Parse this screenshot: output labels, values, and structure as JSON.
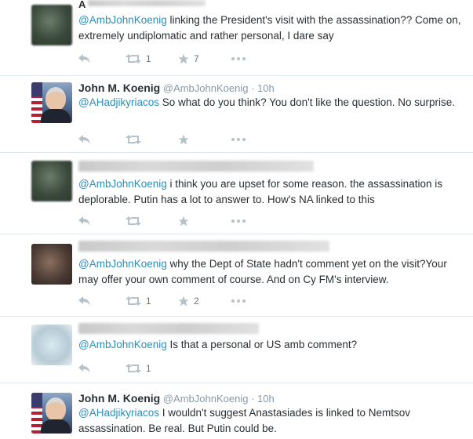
{
  "colors": {
    "mention": "#2a8fbd",
    "meta": "#8899a6",
    "icon": "#b6c2c9",
    "divider": "#e1e8ed",
    "text": "#292f33"
  },
  "tweets": [
    {
      "name_initial": "A",
      "mention": "@AmbJohnKoenig",
      "text": " linking the President's visit with the assassination?? Come on, extremely undiplomatic and rather personal, I dare say",
      "retweet_count": "1",
      "favorite_count": "7"
    },
    {
      "fullname": "John M. Koenig",
      "handle": "@AmbJohnKoenig",
      "dot": "·",
      "time": "10h",
      "mention": "@AHadjikyriacos",
      "text": " So what do you think?  You don't like the question. No surprise."
    },
    {
      "mention": "@AmbJohnKoenig",
      "text": " i think you are upset for some reason. the assassination is deplorable. Putin has a lot to answer to. How's NA linked to this"
    },
    {
      "mention": "@AmbJohnKoenig",
      "text": " why the Dept of State hadn't comment yet on the visit?Your may offer your own comment of course. And on Cy FM's interview.",
      "retweet_count": "1",
      "favorite_count": "2"
    },
    {
      "mention": "@AmbJohnKoenig",
      "text": "  Is that a personal  or US amb comment?",
      "retweet_count": "1"
    },
    {
      "fullname": "John M. Koenig",
      "handle": "@AmbJohnKoenig",
      "dot": "·",
      "time": "10h",
      "mention": "@AHadjikyriacos",
      "text": " I wouldn't suggest Anastasiades is linked to Nemtsov assassination. Be real.  But Putin could be."
    }
  ],
  "icons": {
    "reply": "reply-icon",
    "retweet": "retweet-icon",
    "favorite": "star-icon",
    "more": "more-icon"
  }
}
